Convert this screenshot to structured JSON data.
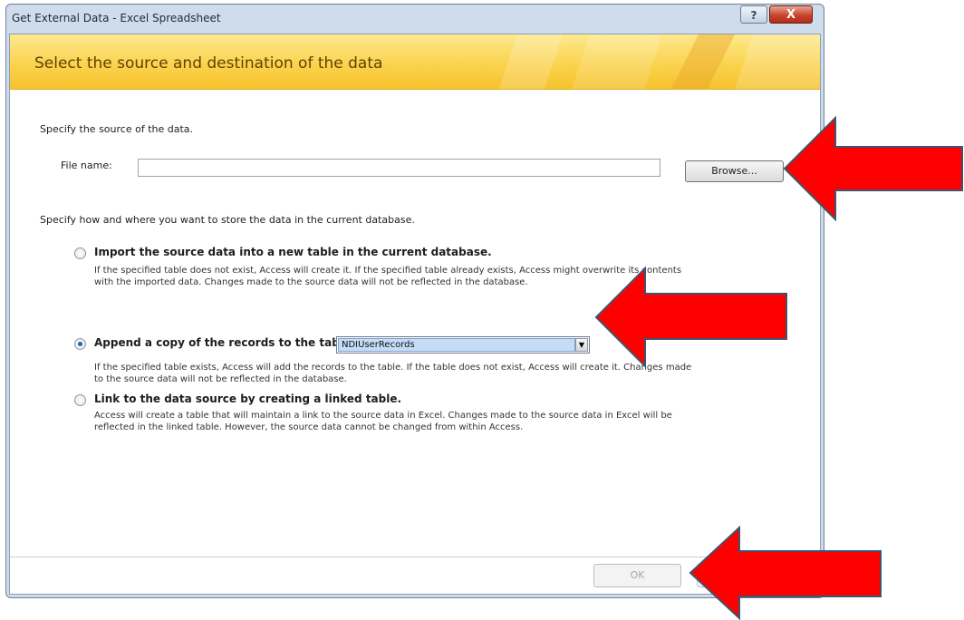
{
  "window": {
    "title": "Get External Data - Excel Spreadsheet",
    "help_label": "?",
    "close_label": "X"
  },
  "banner": {
    "heading": "Select the source and destination of the data"
  },
  "source": {
    "prompt": "Specify the source of the data.",
    "file_label": "File name:",
    "file_value": "",
    "browse_label": "Browse..."
  },
  "destination": {
    "prompt": "Specify how and where you want to store the data in the current database.",
    "options": [
      {
        "title": "Import the source data into a new table in the current database.",
        "selected": false,
        "desc1": "If the specified table does not exist, Access will create it. If the specified table already exists, Access might overwrite its contents",
        "desc2": "with the imported data. Changes made to the source data will not be reflected in the database."
      },
      {
        "title": "Append a copy of the records to the table:",
        "selected": true,
        "table_value": "NDIUserRecords",
        "desc1": "If the specified table exists, Access will add the records to the table. If the table does not exist, Access will create it. Changes made",
        "desc2": "to the source data will not be reflected in the database."
      },
      {
        "title": "Link to the data source by creating a linked table.",
        "selected": false,
        "desc1": "Access will create a table that will maintain a link to the source data in Excel. Changes made to the source data in Excel will be",
        "desc2": "reflected in the linked table. However, the source data cannot be changed from within Access."
      }
    ]
  },
  "footer": {
    "ok_label": "OK",
    "cancel_label": ""
  },
  "colors": {
    "banner": "#fbd34f",
    "annotation_arrow": "#ff0000",
    "window_frame": "#cfdcec"
  }
}
